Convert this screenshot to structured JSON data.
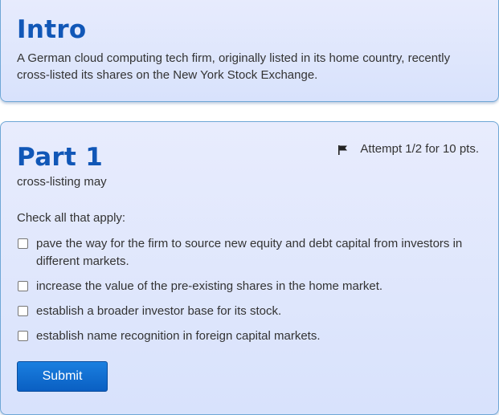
{
  "intro": {
    "title": "Intro",
    "text": "A German cloud computing tech firm, originally listed in its home country, recently cross-listed its shares on the New York Stock Exchange."
  },
  "part": {
    "title": "Part 1",
    "attempt": "Attempt 1/2 for 10 pts.",
    "question": "cross-listing may",
    "instruction": "Check all that apply:",
    "options": [
      {
        "label": "pave the way for the firm to source new equity and debt capital from investors in different markets.",
        "checked": false
      },
      {
        "label": "increase the value of the pre-existing shares in the home market.",
        "checked": false
      },
      {
        "label": "establish a broader investor base for its stock.",
        "checked": false
      },
      {
        "label": "establish name recognition in foreign capital markets.",
        "checked": false
      }
    ],
    "submit_label": "Submit"
  },
  "colors": {
    "title": "#1157b7",
    "card_bg": "#dfe6fd",
    "card_border": "#6fa7d6",
    "button": "#0a6ad2"
  },
  "icons": {
    "attempt_flag": "flag-icon"
  }
}
